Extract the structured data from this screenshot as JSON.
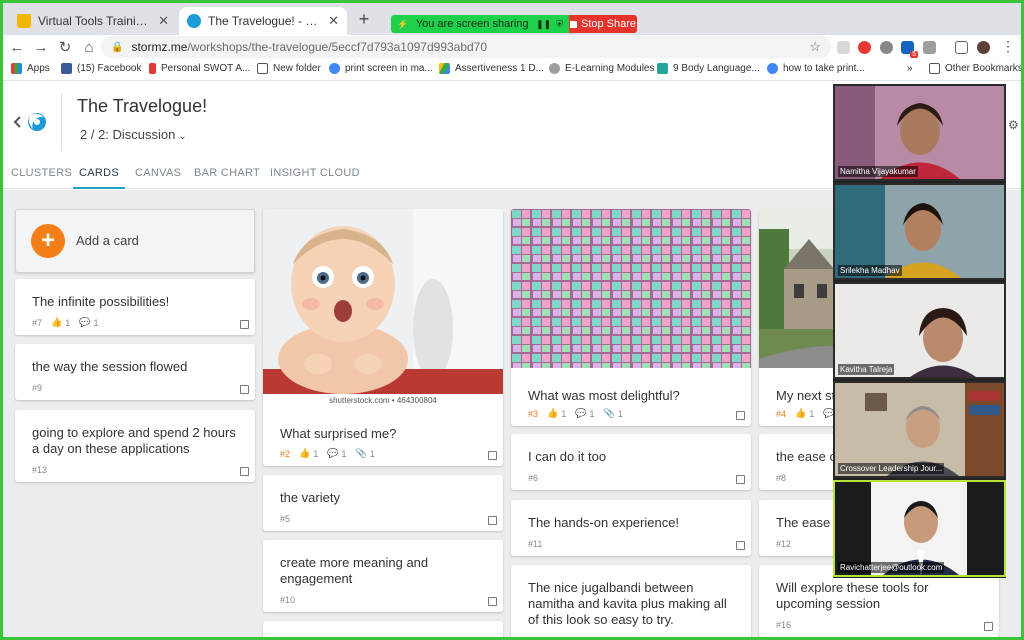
{
  "browser": {
    "tabs": [
      {
        "title": "Virtual Tools Training_Co, Onli",
        "active": false
      },
      {
        "title": "The Travelogue! - Stormz",
        "active": true
      }
    ],
    "share": {
      "status": "You are screen sharing",
      "stop": "Stop Share"
    },
    "address": {
      "host": "stormz.me",
      "path": "/workshops/the-travelogue/5eccf7d793a1097d993abd70"
    },
    "ext_badge": "5",
    "bookmarks": [
      "Apps",
      "(15) Facebook",
      "Personal SWOT A...",
      "New folder",
      "print screen in ma...",
      "Assertiveness 1 D...",
      "E-Learning Modules",
      "9 Body Language...",
      "how to take print..."
    ],
    "more": "»",
    "other": "Other Bookmarks"
  },
  "app": {
    "title": "The Travelogue!",
    "subtitle": "2 / 2: Discussion",
    "tabs": [
      "CLUSTERS",
      "CARDS",
      "CANVAS",
      "BAR CHART",
      "INSIGHT CLOUD"
    ],
    "add_card": "Add a card",
    "credit": "shutterstock.com • 464300804",
    "cards": [
      {
        "text": "The infinite possibilities!",
        "num": "#7",
        "likes": "1",
        "comments": "1"
      },
      {
        "text": "the way the session flowed",
        "num": "#9"
      },
      {
        "text": "going to explore and spend 2 hours a day on these applications",
        "num": "#13"
      },
      {
        "text": "What surprised me?",
        "num": "#2",
        "likes": "1",
        "comments": "1",
        "attach": "1"
      },
      {
        "text": "the variety",
        "num": "#5"
      },
      {
        "text": "create more meaning and engagement",
        "num": "#10"
      },
      {
        "text": "What was most delightful?",
        "num": "#3",
        "likes": "1",
        "comments": "1",
        "attach": "1"
      },
      {
        "text": "I can do it too",
        "num": "#6"
      },
      {
        "text": "The hands-on experience!",
        "num": "#11"
      },
      {
        "text": "The nice jugalbandi between namitha and kavita plus making all of this look so easy to try.",
        "num": ""
      },
      {
        "text": "My next st",
        "num": "#4",
        "likes": "1",
        "comments": "1"
      },
      {
        "text": "the ease o",
        "num": "#8"
      },
      {
        "text": "The ease o",
        "num": "#12"
      },
      {
        "text": "Will explore these tools for upcoming session",
        "num": "#16"
      }
    ]
  },
  "participants": [
    "Namitha Vijayakumar",
    "Srilekha Madhav",
    "Kavitha Talreja",
    "Crossover Leadership Jour...",
    "Ravichatterjee@outlook.com"
  ]
}
